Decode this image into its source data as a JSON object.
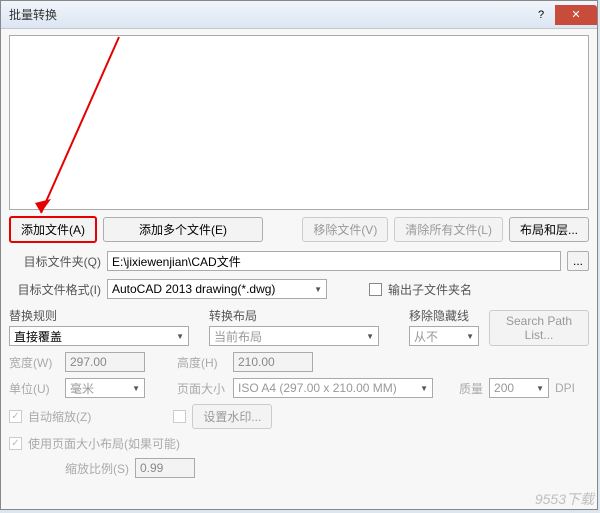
{
  "window": {
    "title": "批量转换"
  },
  "buttons": {
    "add_file": "添加文件(A)",
    "add_multi": "添加多个文件(E)",
    "remove_file": "移除文件(V)",
    "clear_all": "清除所有文件(L)",
    "layout_layers": "布局和层..."
  },
  "target_folder": {
    "label": "目标文件夹(Q)",
    "value": "E:\\jixiewenjian\\CAD文件",
    "browse": "..."
  },
  "target_format": {
    "label": "目标文件格式(I)",
    "value": "AutoCAD 2013 drawing(*.dwg)"
  },
  "output_subfolder": {
    "label": "输出子文件夹名"
  },
  "columns": {
    "replace_rule": {
      "label": "替换规则",
      "value": "直接覆盖"
    },
    "convert_layout": {
      "label": "转换布局",
      "value": "当前布局"
    },
    "remove_hidden": {
      "label": "移除隐藏线",
      "value": "从不"
    },
    "search_path": "Search Path List..."
  },
  "dims": {
    "width_label": "宽度(W)",
    "width_value": "297.00",
    "height_label": "高度(H)",
    "height_value": "210.00",
    "unit_label": "单位(U)",
    "unit_value": "毫米",
    "page_size_label": "页面大小",
    "page_size_value": "ISO A4 (297.00 x 210.00 MM)",
    "quality_label": "质量",
    "quality_value": "200",
    "dpi": "DPI"
  },
  "checks": {
    "auto_scale": "自动缩放(Z)",
    "set_watermark": "设置水印...",
    "use_page_layout": "使用页面大小布局(如果可能)",
    "scale_ratio_label": "缩放比例(S)",
    "scale_ratio_value": "0.99"
  },
  "watermark": "9553下载"
}
